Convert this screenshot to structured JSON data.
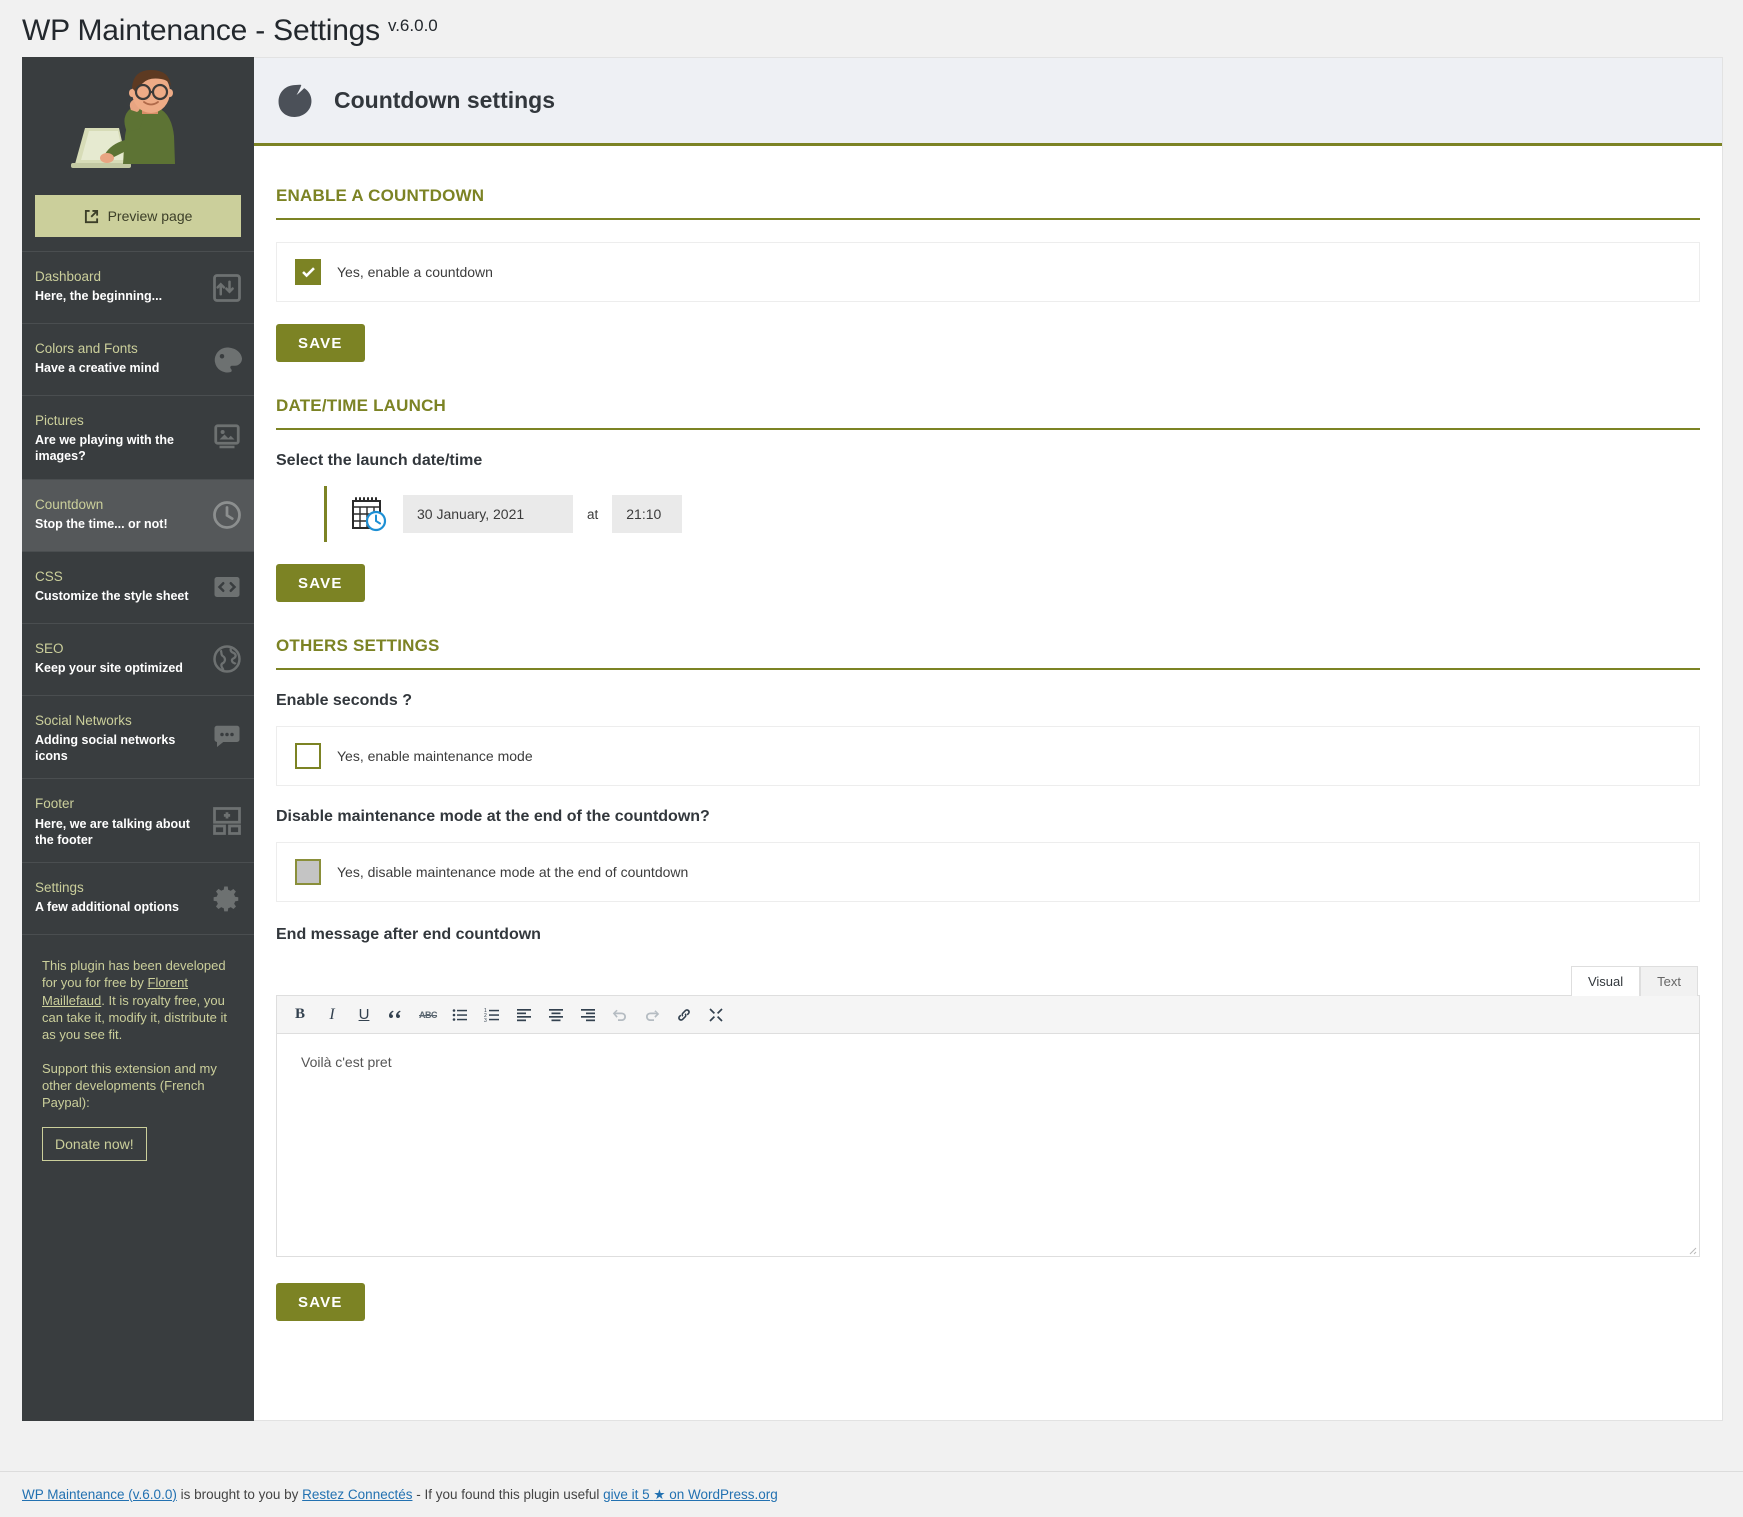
{
  "header": {
    "title": "WP Maintenance - Settings",
    "version": "v.6.0.0"
  },
  "sidebar": {
    "preview_label": "Preview page",
    "items": [
      {
        "title": "Dashboard",
        "subtitle": "Here, the beginning...",
        "icon": "dashboard-icon",
        "active": false
      },
      {
        "title": "Colors and Fonts",
        "subtitle": "Have a creative mind",
        "icon": "palette-icon",
        "active": false
      },
      {
        "title": "Pictures",
        "subtitle": "Are we playing with the images?",
        "icon": "image-icon",
        "active": false
      },
      {
        "title": "Countdown",
        "subtitle": "Stop the time... or not!",
        "icon": "clock-icon",
        "active": true
      },
      {
        "title": "CSS",
        "subtitle": "Customize the style sheet",
        "icon": "code-icon",
        "active": false
      },
      {
        "title": "SEO",
        "subtitle": "Keep your site optimized",
        "icon": "globe-icon",
        "active": false
      },
      {
        "title": "Social Networks",
        "subtitle": "Adding social networks icons",
        "icon": "chat-icon",
        "active": false
      },
      {
        "title": "Footer",
        "subtitle": "Here, we are talking about the footer",
        "icon": "layout-icon",
        "active": false
      },
      {
        "title": "Settings",
        "subtitle": "A few additional options",
        "icon": "gear-icon",
        "active": false
      }
    ],
    "note_part1": "This plugin has been developed for you for free by ",
    "note_author": "Florent Maillefaud",
    "note_part2": ". It is royalty free, you can take it, modify it, distribute it as you see fit.",
    "note_support": "Support this extension and my other developments (French Paypal):",
    "donate_label": "Donate now!"
  },
  "main": {
    "page_heading": "Countdown settings",
    "section_enable": {
      "title": "ENABLE A COUNTDOWN",
      "checkbox_label": "Yes, enable a countdown",
      "checked": true,
      "save_label": "SAVE"
    },
    "section_datetime": {
      "title": "DATE/TIME LAUNCH",
      "field_label": "Select the launch date/time",
      "date_value": "30 January, 2021",
      "at_label": "at",
      "time_value": "21:10",
      "save_label": "SAVE"
    },
    "section_others": {
      "title": "OTHERS SETTINGS",
      "seconds_label": "Enable seconds ?",
      "seconds_checkbox_label": "Yes, enable maintenance mode",
      "disable_label": "Disable maintenance mode at the end of the countdown?",
      "disable_checkbox_label": "Yes, disable maintenance mode at the end of countdown",
      "endmessage_label": "End message after end countdown",
      "tab_visual": "Visual",
      "tab_text": "Text",
      "editor_content": "Voilà c'est pret",
      "save_label": "SAVE",
      "toolbar": [
        {
          "name": "bold-icon",
          "glyph": "B"
        },
        {
          "name": "italic-icon",
          "glyph": "I"
        },
        {
          "name": "underline-icon",
          "glyph": "U"
        },
        {
          "name": "blockquote-icon",
          "glyph": "“"
        },
        {
          "name": "strikethrough-icon",
          "glyph": "ABC"
        },
        {
          "name": "bullet-list-icon",
          "glyph": ""
        },
        {
          "name": "numbered-list-icon",
          "glyph": ""
        },
        {
          "name": "align-left-icon",
          "glyph": ""
        },
        {
          "name": "align-center-icon",
          "glyph": ""
        },
        {
          "name": "align-right-icon",
          "glyph": ""
        },
        {
          "name": "undo-icon",
          "glyph": ""
        },
        {
          "name": "redo-icon",
          "glyph": ""
        },
        {
          "name": "link-icon",
          "glyph": ""
        },
        {
          "name": "fullscreen-icon",
          "glyph": ""
        }
      ]
    }
  },
  "footer": {
    "link1": "WP Maintenance (v.6.0.0)",
    "text1": " is brought to you by ",
    "link2": "Restez Connectés",
    "text2": " - If you found this plugin useful ",
    "link3_pre": "give it 5 ",
    "link3_star": "★",
    "link3_post": " on WordPress.org"
  },
  "colors": {
    "accent": "#7c8324",
    "accent_light": "#cbcf9b",
    "sidebar_bg": "#393d3f",
    "link": "#2271b1"
  }
}
